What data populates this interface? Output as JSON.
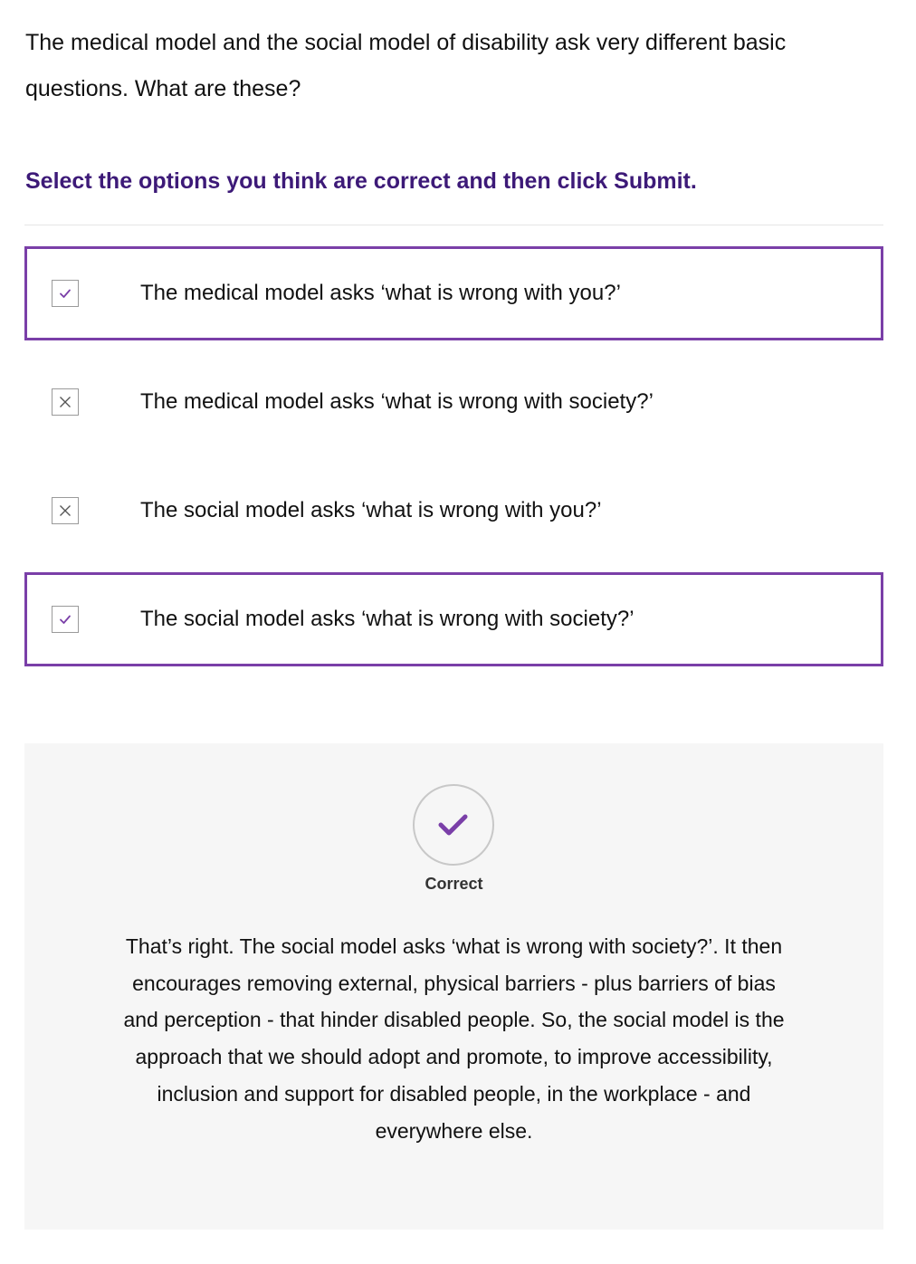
{
  "question": {
    "text": "The medical model and the social model of disability ask very different basic questions. What are these?"
  },
  "instruction": "Select the options you think are correct and then click Submit.",
  "options": [
    {
      "label": "The medical model asks ‘what is wrong with you?’",
      "selected": true,
      "icon": "check-icon"
    },
    {
      "label": "The medical model asks ‘what is wrong with society?’",
      "selected": false,
      "icon": "cross-icon"
    },
    {
      "label": "The social model asks ‘what is wrong with you?’",
      "selected": false,
      "icon": "cross-icon"
    },
    {
      "label": "The social model asks ‘what is wrong with society?’",
      "selected": true,
      "icon": "check-icon"
    }
  ],
  "feedback": {
    "status_icon": "check-icon",
    "status_label": "Correct",
    "text": "That’s right. The social model asks ‘what is wrong with society?’. It then encourages removing external, physical barriers - plus barriers of bias and perception - that hinder disabled people. So, the social model is the approach that we should adopt and promote, to improve accessibility, inclusion and support for disabled people, in the workplace - and everywhere else."
  },
  "colors": {
    "accent": "#7a3fa8",
    "instruction": "#3d1a78",
    "feedback_bg": "#f6f6f6"
  }
}
